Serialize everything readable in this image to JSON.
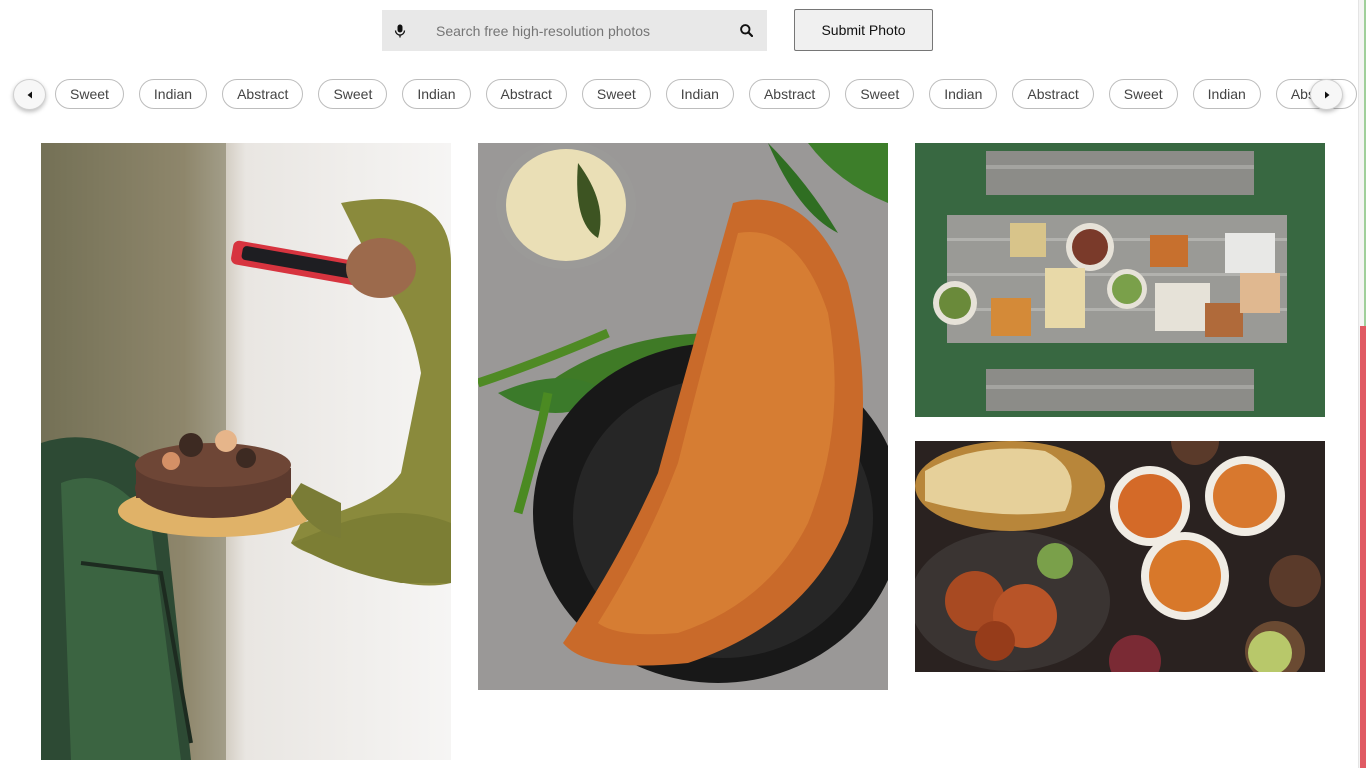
{
  "search": {
    "placeholder": "Search free high-resolution photos",
    "mic_icon": "microphone-icon",
    "search_icon": "magnifier-icon"
  },
  "submit_label": "Submit Photo",
  "tags": [
    "Sweet",
    "Indian",
    "Abstract",
    "Sweet",
    "Indian",
    "Abstract",
    "Sweet",
    "Indian",
    "Abstract",
    "Sweet",
    "Indian",
    "Abstract",
    "Sweet",
    "Indian",
    "Abstract"
  ],
  "carousel": {
    "prev_icon": "caret-left-icon",
    "next_icon": "caret-right-icon"
  },
  "photos": [
    {
      "subject": "cake-held-while-photographed"
    },
    {
      "subject": "dosa-with-chutney"
    },
    {
      "subject": "picnic-table-spread"
    },
    {
      "subject": "indian-curry-feast"
    }
  ],
  "colors": {
    "scrollbar_thumb": "#e05a63",
    "search_bg": "#e8e8e8"
  }
}
